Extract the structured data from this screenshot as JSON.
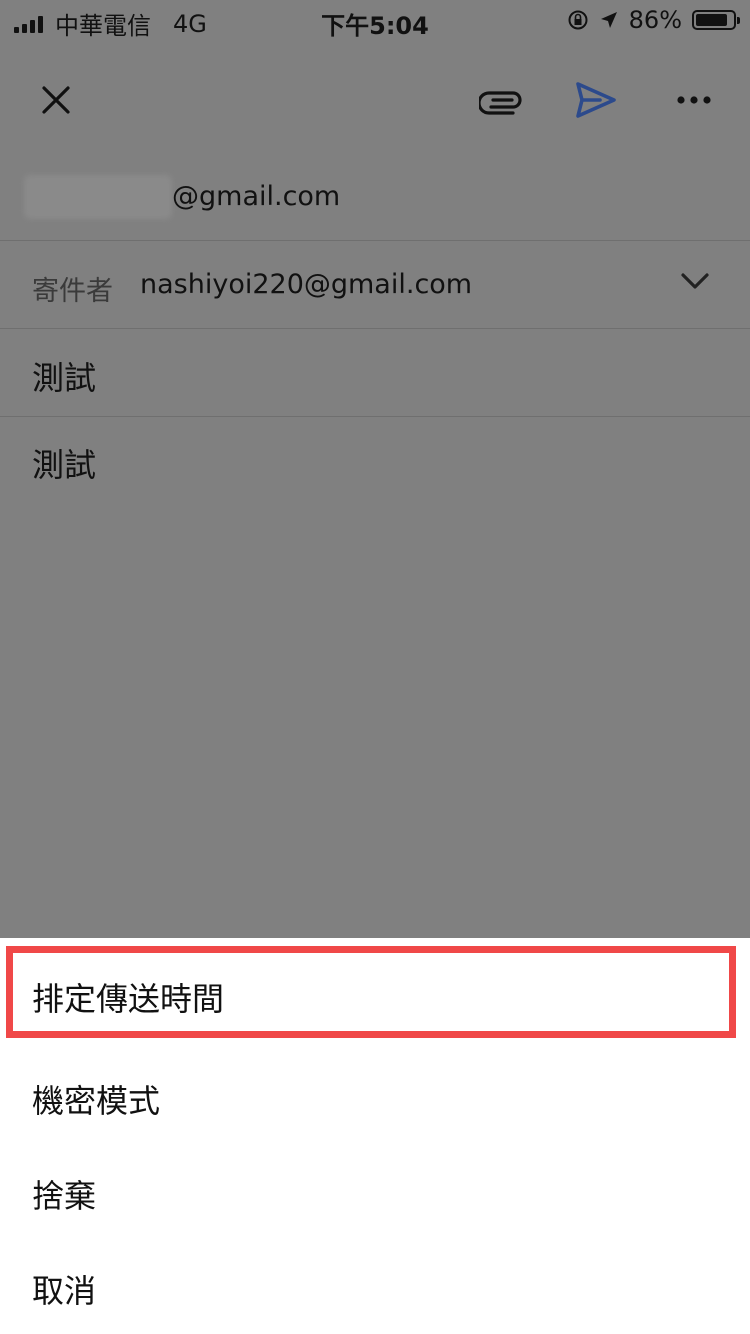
{
  "status_bar": {
    "carrier": "中華電信",
    "network": "4G",
    "time": "下午5:04",
    "battery_text": "86%",
    "battery_level": 0.86
  },
  "toolbar": {
    "icons": [
      "close-icon",
      "attach-icon",
      "send-icon",
      "more-icon"
    ],
    "send_color": "#2c4a8c"
  },
  "compose": {
    "to_value": "@gmail.com",
    "from_label": "寄件者",
    "from_value": "nashiyoi220@gmail.com",
    "subject": "測試",
    "body": "測試"
  },
  "sheet": {
    "items": [
      {
        "label": "排定傳送時間"
      },
      {
        "label": "機密模式"
      },
      {
        "label": "捨棄"
      },
      {
        "label": "取消"
      }
    ],
    "highlight_color": "#f04848"
  }
}
